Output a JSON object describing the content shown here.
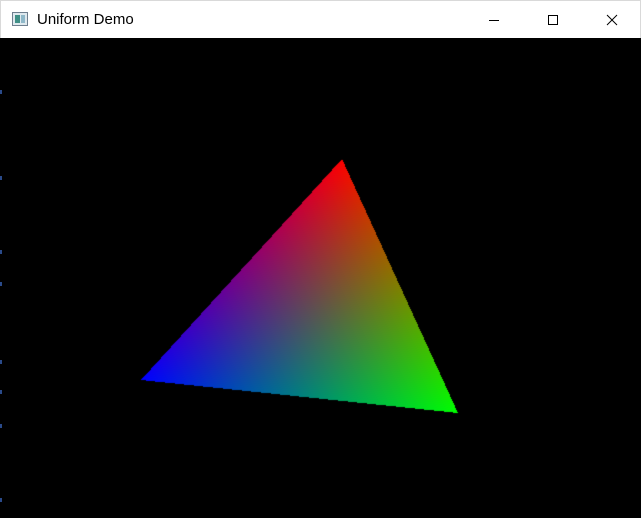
{
  "window": {
    "title": "Uniform Demo",
    "app_icon": "window-app-icon",
    "controls": {
      "minimize_icon": "minimize-icon",
      "maximize_icon": "maximize-icon",
      "close_icon": "close-icon"
    }
  },
  "scene": {
    "background": "#000000",
    "triangle": {
      "vertices": [
        {
          "name": "top",
          "color": "#ff0000"
        },
        {
          "name": "bottom-left",
          "color": "#0000ff"
        },
        {
          "name": "bottom-right",
          "color": "#00ff00"
        }
      ]
    }
  }
}
